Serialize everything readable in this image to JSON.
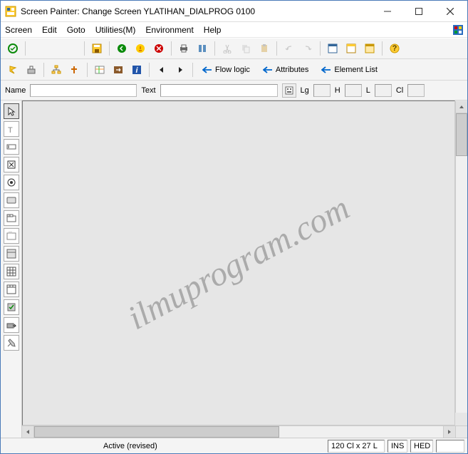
{
  "title": "Screen Painter:  Change Screen YLATIHAN_DIALPROG 0100",
  "menus": {
    "screen": "Screen",
    "edit": "Edit",
    "goto": "Goto",
    "utilities": "Utilities(M)",
    "environment": "Environment",
    "help": "Help"
  },
  "nav": {
    "flow_logic": "Flow logic",
    "attributes": "Attributes",
    "element_list": "Element List"
  },
  "fields": {
    "name_label": "Name",
    "name_value": "",
    "text_label": "Text",
    "text_value": "",
    "lg_label": "Lg",
    "lg_value": "",
    "h_label": "H",
    "h_value": "",
    "l_label": "L",
    "l_value": "",
    "cl_label": "Cl",
    "cl_value": ""
  },
  "watermark": "ilmuprogram.com",
  "status": {
    "state": "Active (revised)",
    "dims": "120 Cl x 27 L",
    "ins": "INS",
    "mode": "HED"
  }
}
